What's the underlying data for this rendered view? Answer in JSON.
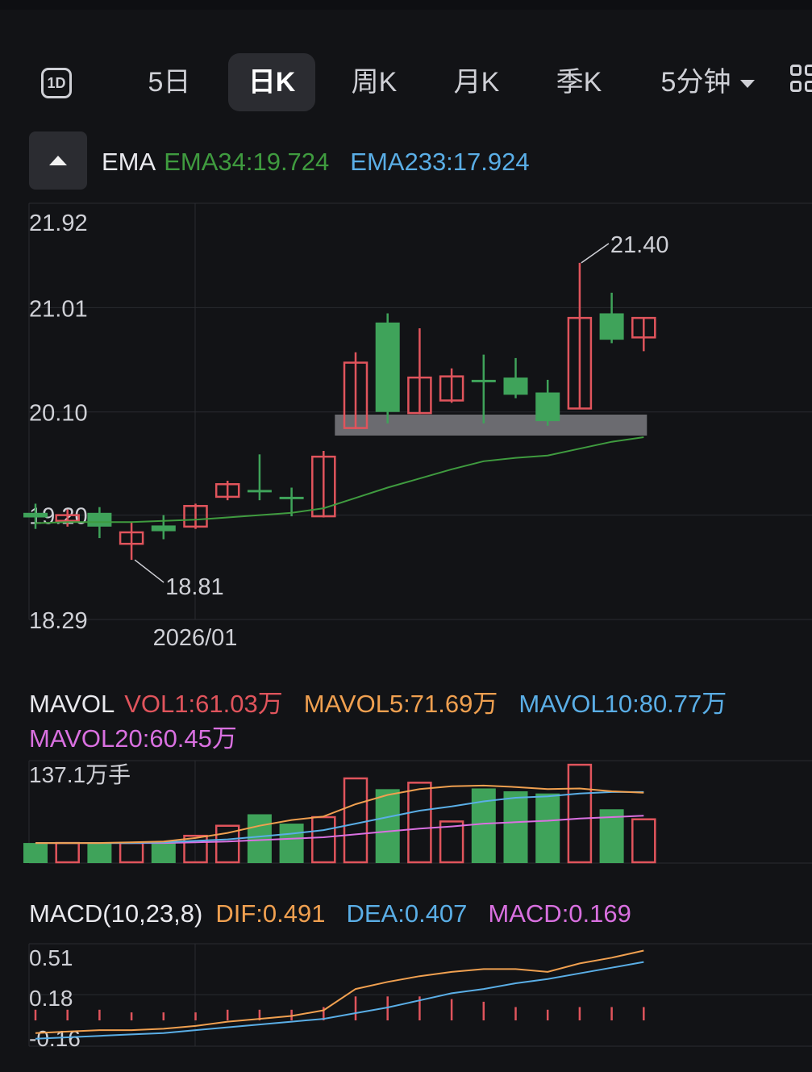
{
  "tabs": {
    "one_day_icon_label": "1D",
    "items": [
      "5日",
      "日K",
      "周K",
      "月K",
      "季K",
      "5分钟"
    ],
    "active": "日K"
  },
  "ema": {
    "label": "EMA",
    "ema34": "EMA34:19.724",
    "ema233": "EMA233:17.924"
  },
  "price_axis": [
    "21.92",
    "21.01",
    "20.10",
    "19.20",
    "18.29"
  ],
  "price_annotations": {
    "high": "21.40",
    "low": "18.81"
  },
  "date_label": "2026/01",
  "mavol": {
    "label": "MAVOL",
    "vol1": "VOL1:61.03万",
    "mavol5": "MAVOL5:71.69万",
    "mavol10": "MAVOL10:80.77万",
    "mavol20": "MAVOL20:60.45万",
    "axis_max": "137.1万手"
  },
  "macd": {
    "label": "MACD(10,23,8)",
    "dif": "DIF:0.491",
    "dea": "DEA:0.407",
    "macd": "MACD:0.169",
    "axis": [
      "0.51",
      "0.18",
      "-0.16"
    ]
  },
  "colors": {
    "up": "#e0545c",
    "down": "#3fa35a",
    "ema34": "#3f9b3f",
    "ema233": "#5aaee6",
    "mavol5": "#f0a050",
    "mavol10": "#5aaee6",
    "mavol20": "#d970e0",
    "support_zone": "#6b6b70"
  },
  "chart_data": [
    {
      "type": "candlestick",
      "ylim": [
        18.29,
        21.92
      ],
      "candles": [
        {
          "o": 19.22,
          "h": 19.3,
          "l": 19.08,
          "c": 19.18,
          "dir": "down"
        },
        {
          "o": 19.15,
          "h": 19.25,
          "l": 19.1,
          "c": 19.2,
          "dir": "up"
        },
        {
          "o": 19.22,
          "h": 19.27,
          "l": 19.0,
          "c": 19.1,
          "dir": "down"
        },
        {
          "o": 18.95,
          "h": 19.14,
          "l": 18.81,
          "c": 19.05,
          "dir": "up"
        },
        {
          "o": 19.11,
          "h": 19.2,
          "l": 18.99,
          "c": 19.06,
          "dir": "down"
        },
        {
          "o": 19.1,
          "h": 19.3,
          "l": 19.08,
          "c": 19.28,
          "dir": "up"
        },
        {
          "o": 19.36,
          "h": 19.5,
          "l": 19.33,
          "c": 19.47,
          "dir": "up"
        },
        {
          "o": 19.42,
          "h": 19.73,
          "l": 19.33,
          "c": 19.4,
          "dir": "down"
        },
        {
          "o": 19.36,
          "h": 19.44,
          "l": 19.19,
          "c": 19.35,
          "dir": "down"
        },
        {
          "o": 19.19,
          "h": 19.76,
          "l": 19.18,
          "c": 19.71,
          "dir": "up"
        },
        {
          "o": 19.96,
          "h": 20.62,
          "l": 19.95,
          "c": 20.53,
          "dir": "up"
        },
        {
          "o": 20.88,
          "h": 20.96,
          "l": 20.0,
          "c": 20.1,
          "dir": "down"
        },
        {
          "o": 20.09,
          "h": 20.83,
          "l": 20.08,
          "c": 20.4,
          "dir": "up"
        },
        {
          "o": 20.2,
          "h": 20.48,
          "l": 20.18,
          "c": 20.41,
          "dir": "up"
        },
        {
          "o": 20.38,
          "h": 20.6,
          "l": 20.0,
          "c": 20.38,
          "dir": "down"
        },
        {
          "o": 20.4,
          "h": 20.57,
          "l": 20.22,
          "c": 20.25,
          "dir": "down"
        },
        {
          "o": 20.27,
          "h": 20.38,
          "l": 19.98,
          "c": 20.02,
          "dir": "down"
        },
        {
          "o": 20.13,
          "h": 21.4,
          "l": 20.13,
          "c": 20.92,
          "dir": "up"
        },
        {
          "o": 20.96,
          "h": 21.14,
          "l": 20.7,
          "c": 20.73,
          "dir": "down"
        },
        {
          "o": 20.75,
          "h": 20.92,
          "l": 20.63,
          "c": 20.92,
          "dir": "up"
        }
      ],
      "ema34": [
        19.13,
        19.14,
        19.14,
        19.14,
        19.15,
        19.16,
        19.18,
        19.2,
        19.22,
        19.26,
        19.35,
        19.44,
        19.52,
        19.6,
        19.67,
        19.7,
        19.72,
        19.78,
        19.84,
        19.88
      ]
    },
    {
      "type": "bar",
      "ylim": [
        0,
        137.1
      ],
      "volume": [
        28,
        28,
        28,
        28,
        28,
        38,
        52,
        68,
        55,
        64,
        118,
        103,
        112,
        58,
        104,
        100,
        97,
        137,
        75,
        61
      ],
      "vol_dir": [
        "down",
        "up",
        "down",
        "up",
        "down",
        "up",
        "up",
        "down",
        "down",
        "up",
        "up",
        "down",
        "up",
        "up",
        "down",
        "down",
        "down",
        "up",
        "down",
        "up"
      ],
      "mavol5": [
        28,
        28,
        28,
        29,
        30,
        35,
        42,
        52,
        60,
        65,
        82,
        95,
        103,
        107,
        108,
        106,
        103,
        104,
        100,
        98
      ],
      "mavol10": [
        28,
        28,
        28,
        28,
        29,
        31,
        33,
        37,
        41,
        46,
        55,
        64,
        73,
        79,
        86,
        91,
        93,
        97,
        99,
        99
      ],
      "mavol20": [
        28,
        28,
        28,
        28,
        28,
        29,
        30,
        32,
        34,
        36,
        40,
        44,
        48,
        51,
        55,
        57,
        59,
        62,
        64,
        66
      ]
    },
    {
      "type": "line",
      "ylim": [
        -0.16,
        0.51
      ],
      "dif": [
        -0.09,
        -0.08,
        -0.07,
        -0.07,
        -0.06,
        -0.04,
        -0.01,
        0.01,
        0.03,
        0.07,
        0.22,
        0.27,
        0.31,
        0.34,
        0.36,
        0.36,
        0.34,
        0.4,
        0.44,
        0.49
      ],
      "dea": [
        -0.13,
        -0.12,
        -0.11,
        -0.1,
        -0.09,
        -0.07,
        -0.05,
        -0.03,
        -0.01,
        0.01,
        0.05,
        0.09,
        0.14,
        0.19,
        0.22,
        0.26,
        0.29,
        0.33,
        0.37,
        0.41
      ],
      "macd_hist": [
        0.04,
        0.04,
        0.04,
        0.03,
        0.03,
        0.03,
        0.04,
        0.04,
        0.04,
        0.05,
        0.09,
        0.09,
        0.09,
        0.08,
        0.07,
        0.05,
        0.04,
        0.05,
        0.05,
        0.05
      ]
    }
  ]
}
